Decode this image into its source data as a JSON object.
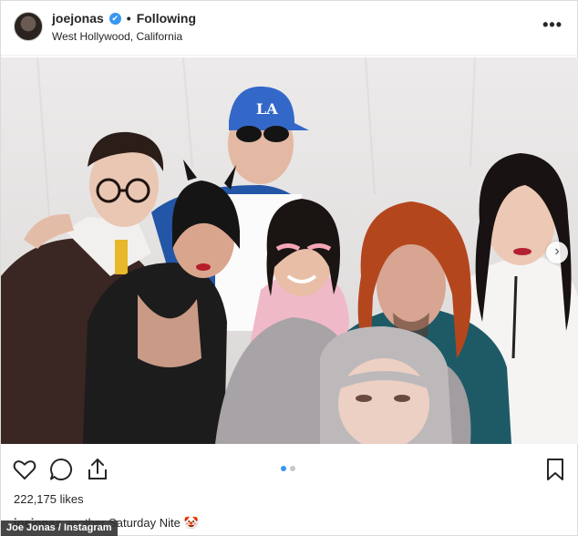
{
  "header": {
    "username": "joejonas",
    "verified_glyph": "✔",
    "separator": "•",
    "follow_status": "Following",
    "location": "West Hollywood, California",
    "more_glyph": "•••"
  },
  "photo": {
    "next_glyph": "›"
  },
  "actions": {
    "icons": [
      "heart-icon",
      "comment-icon",
      "share-icon",
      "bookmark-icon"
    ]
  },
  "pagination": {
    "count": 2,
    "active": 1
  },
  "likes": "222,175 likes",
  "caption": {
    "username": "joejonas",
    "text": "another Saturday Nite 🤡"
  },
  "credit": "Joe Jonas / Instagram",
  "colors": {
    "accent": "#3897f0",
    "text": "#262626"
  }
}
